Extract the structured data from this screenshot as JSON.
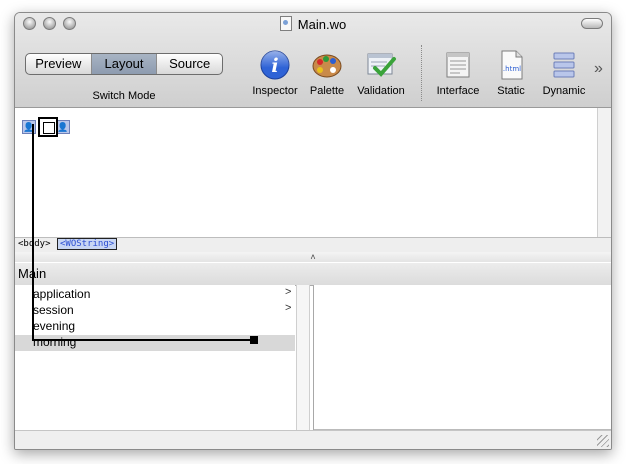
{
  "window": {
    "title": "Main.wo"
  },
  "toolbar": {
    "mode_buttons": [
      "Preview",
      "Layout",
      "Source"
    ],
    "active_mode": "Layout",
    "switch_mode_label": "Switch Mode",
    "items": [
      {
        "label": "Inspector",
        "icon": "info-icon"
      },
      {
        "label": "Palette",
        "icon": "palette-icon"
      },
      {
        "label": "Validation",
        "icon": "validation-icon"
      },
      {
        "label": "Interface",
        "icon": "interface-icon"
      },
      {
        "label": "Static",
        "icon": "html-file-icon",
        "icon_text": ".html"
      },
      {
        "label": "Dynamic",
        "icon": "dynamic-icon"
      }
    ],
    "overflow": "»"
  },
  "path_bar": {
    "body_tag": "<body>",
    "element_tag": "<WOString>"
  },
  "splitter_glyph": "˄",
  "browser": {
    "title": "Main",
    "items": [
      {
        "label": "application",
        "has_children": true,
        "arrow": ">"
      },
      {
        "label": "session",
        "has_children": true,
        "arrow": ">"
      },
      {
        "label": "evening",
        "has_children": false,
        "arrow": ""
      },
      {
        "label": "morning",
        "has_children": false,
        "arrow": "",
        "selected": true
      }
    ]
  },
  "colors": {
    "selection_row": "#d8d8d8",
    "wo_tag_bg": "#c8d6f3",
    "wo_tag_text": "#2c4fd2",
    "info_blue": "#2f63d6"
  }
}
